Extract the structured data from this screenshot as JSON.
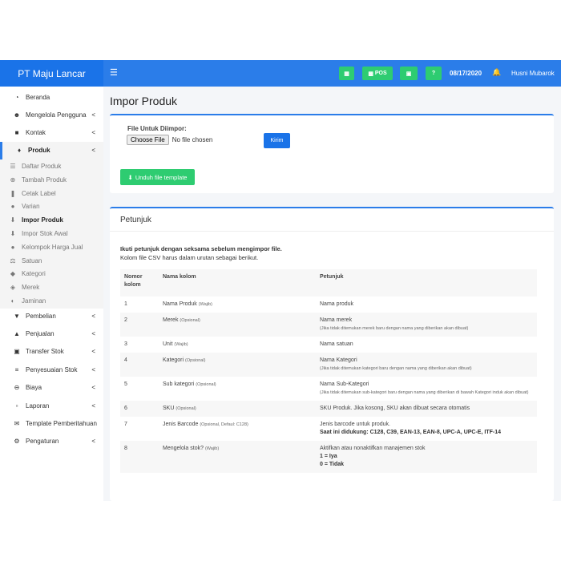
{
  "brand": "PT Maju Lancar",
  "topbar": {
    "pos_label": "POS",
    "date": "08/17/2020",
    "user": "Husni Mubarok"
  },
  "sidebar": {
    "items_top": [
      {
        "label": "Beranda",
        "icon": "dashboard-icon"
      },
      {
        "label": "Mengelola Pengguna",
        "icon": "users-icon",
        "chevron": "<"
      },
      {
        "label": "Kontak",
        "icon": "address-book-icon",
        "chevron": "<"
      },
      {
        "label": "Produk",
        "icon": "cubes-icon",
        "chevron": "<"
      }
    ],
    "sub_items": [
      {
        "label": "Daftar Produk",
        "icon": "list-icon"
      },
      {
        "label": "Tambah Produk",
        "icon": "plus-circle-icon"
      },
      {
        "label": "Cetak Label",
        "icon": "barcode-icon"
      },
      {
        "label": "Varian",
        "icon": "circle-icon"
      },
      {
        "label": "Impor Produk",
        "icon": "download-icon"
      },
      {
        "label": "Impor Stok Awal",
        "icon": "download-icon"
      },
      {
        "label": "Kelompok Harga Jual",
        "icon": "circle-icon"
      },
      {
        "label": "Satuan",
        "icon": "balance-scale-icon"
      },
      {
        "label": "Kategori",
        "icon": "tags-icon"
      },
      {
        "label": "Merek",
        "icon": "gem-icon"
      },
      {
        "label": "Jaminan",
        "icon": "shield-icon"
      }
    ],
    "items_bottom": [
      {
        "label": "Pembelian",
        "icon": "arrow-circle-down-icon",
        "chevron": "<"
      },
      {
        "label": "Penjualan",
        "icon": "arrow-circle-up-icon",
        "chevron": "<"
      },
      {
        "label": "Transfer Stok",
        "icon": "truck-icon",
        "chevron": "<"
      },
      {
        "label": "Penyesuaian Stok",
        "icon": "database-icon",
        "chevron": "<"
      },
      {
        "label": "Biaya",
        "icon": "minus-circle-icon",
        "chevron": "<"
      },
      {
        "label": "Laporan",
        "icon": "chart-icon",
        "chevron": "<"
      },
      {
        "label": "Template Pemberitahuan",
        "icon": "envelope-icon"
      },
      {
        "label": "Pengaturan",
        "icon": "cog-icon",
        "chevron": "<"
      }
    ]
  },
  "page": {
    "title": "Impor Produk"
  },
  "upload": {
    "label": "File Untuk Diimpor:",
    "choose": "Choose File",
    "no_file": "No file chosen",
    "submit": "Kirim",
    "download": "Unduh file template"
  },
  "guide": {
    "title": "Petunjuk",
    "intro_bold": "Ikuti petunjuk dengan seksama sebelum mengimpor file.",
    "intro": "Kolom file CSV harus dalam urutan sebagai berikut.",
    "headers": [
      "Nomor kolom",
      "Nama kolom",
      "Petunjuk"
    ],
    "rows": [
      {
        "no": "1",
        "name": "Nama Produk",
        "note": "(Wajib)",
        "desc": "Nama produk",
        "extra": "",
        "bold": ""
      },
      {
        "no": "2",
        "name": "Merek",
        "note": "(Opsional)",
        "desc": "Nama merek",
        "extra": "(Jika tidak ditemukan merek baru dengan nama yang diberikan akan dibuat)",
        "bold": ""
      },
      {
        "no": "3",
        "name": "Unit",
        "note": "(Wajib)",
        "desc": "Nama satuan",
        "extra": "",
        "bold": ""
      },
      {
        "no": "4",
        "name": "Kategori",
        "note": "(Opsional)",
        "desc": "Nama Kategori",
        "extra": "(Jika tidak ditemukan kategori baru dengan nama yang diberikan akan dibuat)",
        "bold": ""
      },
      {
        "no": "5",
        "name": "Sub kategori",
        "note": "(Opsional)",
        "desc": "Nama Sub-Kategori",
        "extra": "(Jika tidak ditemukan sub-kategori baru dengan nama yang diberikan di bawah Kategori induk akan dibuat)",
        "bold": ""
      },
      {
        "no": "6",
        "name": "SKU",
        "note": "(Opsional)",
        "desc": "SKU Produk. Jika kosong, SKU akan dibuat secara otomatis",
        "extra": "",
        "bold": ""
      },
      {
        "no": "7",
        "name": "Jenis Barcode",
        "note": "(Opsional, Defaul: C128)",
        "desc": "Jenis barcode untuk produk.",
        "extra": "",
        "bold": "Saat ini didukung: C128, C39, EAN-13, EAN-8, UPC-A, UPC-E, ITF-14"
      },
      {
        "no": "8",
        "name": "Mengelola stok?",
        "note": "(Wajib)",
        "desc": "Aktifkan atau nonaktifkan manajemen stok",
        "extra": "",
        "bold": "1 = Iya\n0 = Tidak"
      }
    ]
  }
}
